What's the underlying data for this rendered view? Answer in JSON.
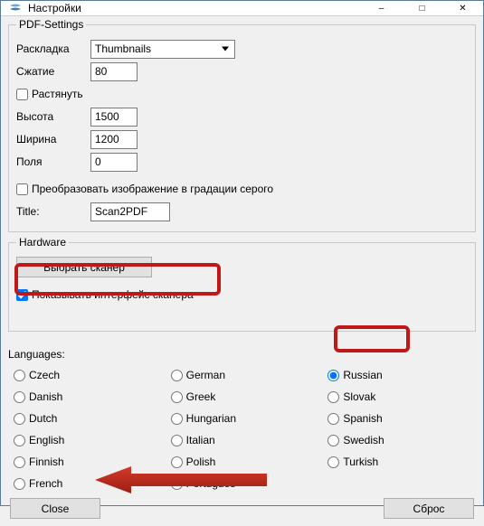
{
  "titlebar": {
    "title": "Настройки"
  },
  "pdf": {
    "legend": "PDF-Settings",
    "layout_label": "Раскладка",
    "layout_value": "Thumbnails",
    "compression_label": "Сжатие",
    "compression_value": "80",
    "stretch_label": "Растянуть",
    "height_label": "Высота",
    "height_value": "1500",
    "width_label": "Ширина",
    "width_value": "1200",
    "margins_label": "Поля",
    "margins_value": "0",
    "grayscale_label": "Преобразовать изображение в градации серого",
    "title_label": "Title:",
    "title_value": "Scan2PDF"
  },
  "hardware": {
    "legend": "Hardware",
    "select_scanner_label": "Выбрать сканер",
    "show_scanner_ui_label": "Показывать интерфейс сканера"
  },
  "languages": {
    "label": "Languages:",
    "col1": [
      "Czech",
      "Danish",
      "Dutch",
      "English",
      "Finnish",
      "French"
    ],
    "col2": [
      "German",
      "Greek",
      "Hungarian",
      "Italian",
      "Polish",
      "Portugues"
    ],
    "col3": [
      "Russian",
      "Slovak",
      "Spanish",
      "Swedish",
      "Turkish"
    ]
  },
  "buttons": {
    "close": "Close",
    "reset": "Сброс"
  }
}
